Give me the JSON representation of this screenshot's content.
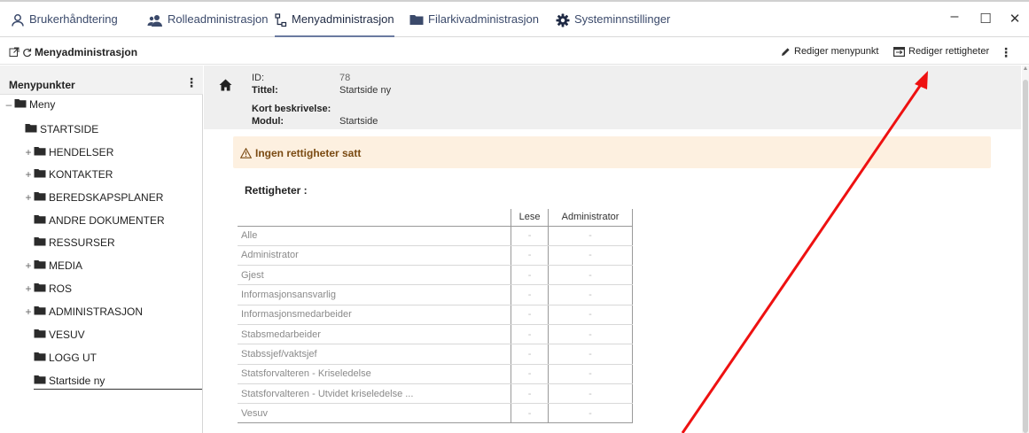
{
  "tabs": [
    {
      "label": "Brukerhåndtering",
      "icon": "user-icon"
    },
    {
      "label": "Rolleadministrasjon",
      "icon": "users-icon"
    },
    {
      "label": "Menyadministrasjon",
      "icon": "menu-tree-icon",
      "active": true
    },
    {
      "label": "Filarkivadministrasjon",
      "icon": "folder-icon"
    },
    {
      "label": "Systeminnstillinger",
      "icon": "gear-icon"
    }
  ],
  "window_controls": {
    "minimize": "–",
    "maximize": "☐",
    "close": "✕"
  },
  "subheader": {
    "title": "Menyadministrasjon",
    "edit_menu_item_label": "Rediger menypunkt",
    "edit_permissions_label": "Rediger rettigheter"
  },
  "sidebar": {
    "header": "Menypunkter",
    "items": [
      {
        "label": "Meny",
        "expander": "–"
      },
      {
        "label": "STARTSIDE",
        "expander": ""
      },
      {
        "label": "HENDELSER",
        "expander": "+"
      },
      {
        "label": "KONTAKTER",
        "expander": "+"
      },
      {
        "label": "BEREDSKAPSPLANER",
        "expander": "+"
      },
      {
        "label": "ANDRE DOKUMENTER",
        "expander": ""
      },
      {
        "label": "RESSURSER",
        "expander": ""
      },
      {
        "label": "MEDIA",
        "expander": "+"
      },
      {
        "label": "ROS",
        "expander": "+"
      },
      {
        "label": "ADMINISTRASJON",
        "expander": "+"
      },
      {
        "label": "VESUV",
        "expander": ""
      },
      {
        "label": "LOGG UT",
        "expander": ""
      },
      {
        "label": "Startside ny",
        "expander": "",
        "selected": true
      }
    ]
  },
  "details": {
    "id_label": "ID:",
    "id_value": "78",
    "title_label": "Tittel:",
    "title_value": "Startside ny",
    "desc_label": "Kort beskrivelse:",
    "desc_value": "",
    "module_label": "Modul:",
    "module_value": "Startside"
  },
  "alert": {
    "text": "Ingen rettigheter satt",
    "color": "#fdf0e0"
  },
  "permissions": {
    "label": "Rettigheter :",
    "columns": [
      "",
      "Lese",
      "Administrator"
    ],
    "rows": [
      {
        "name": "Alle",
        "lese": "-",
        "admin": "-"
      },
      {
        "name": "Administrator",
        "lese": "-",
        "admin": "-"
      },
      {
        "name": "Gjest",
        "lese": "-",
        "admin": "-"
      },
      {
        "name": "Informasjonsansvarlig",
        "lese": "-",
        "admin": "-"
      },
      {
        "name": "Informasjonsmedarbeider",
        "lese": "-",
        "admin": "-"
      },
      {
        "name": "Stabsmedarbeider",
        "lese": "-",
        "admin": "-"
      },
      {
        "name": "Stabssjef/vaktsjef",
        "lese": "-",
        "admin": "-"
      },
      {
        "name": "Statsforvalteren - Kriseledelse",
        "lese": "-",
        "admin": "-"
      },
      {
        "name": "Statsforvalteren - Utvidet kriseledelse ...",
        "lese": "-",
        "admin": "-"
      },
      {
        "name": "Vesuv",
        "lese": "-",
        "admin": "-"
      }
    ]
  },
  "annotation_color": "#ee1111"
}
